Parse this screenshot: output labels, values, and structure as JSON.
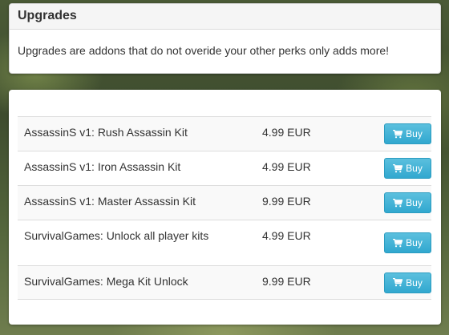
{
  "info": {
    "title": "Upgrades",
    "description": "Upgrades are addons that do not overide your other perks only adds more!"
  },
  "packages": [
    {
      "name": "AssassinS v1: Rush Assassin Kit",
      "price": "4.99 EUR",
      "button_label": "Buy",
      "icon": "shopping-cart-icon"
    },
    {
      "name": "AssassinS v1: Iron Assassin Kit",
      "price": "4.99 EUR",
      "button_label": "Buy",
      "icon": "shopping-cart-icon"
    },
    {
      "name": "AssassinS v1: Master Assassin Kit",
      "price": "9.99 EUR",
      "button_label": "Buy",
      "icon": "shopping-cart-icon"
    },
    {
      "name": "SurvivalGames: Unlock all player kits",
      "price": "4.99 EUR",
      "button_label": "Buy",
      "icon": "shopping-cart-icon"
    },
    {
      "name": "SurvivalGames: Mega Kit Unlock",
      "price": "9.99 EUR",
      "button_label": "Buy",
      "icon": "shopping-cart-icon"
    }
  ],
  "colors": {
    "button": "#5bc0de",
    "button_text": "#ffffff",
    "panel": "#ffffff",
    "heading_bg": "#f5f5f5",
    "stripe": "#f9f9f9"
  }
}
